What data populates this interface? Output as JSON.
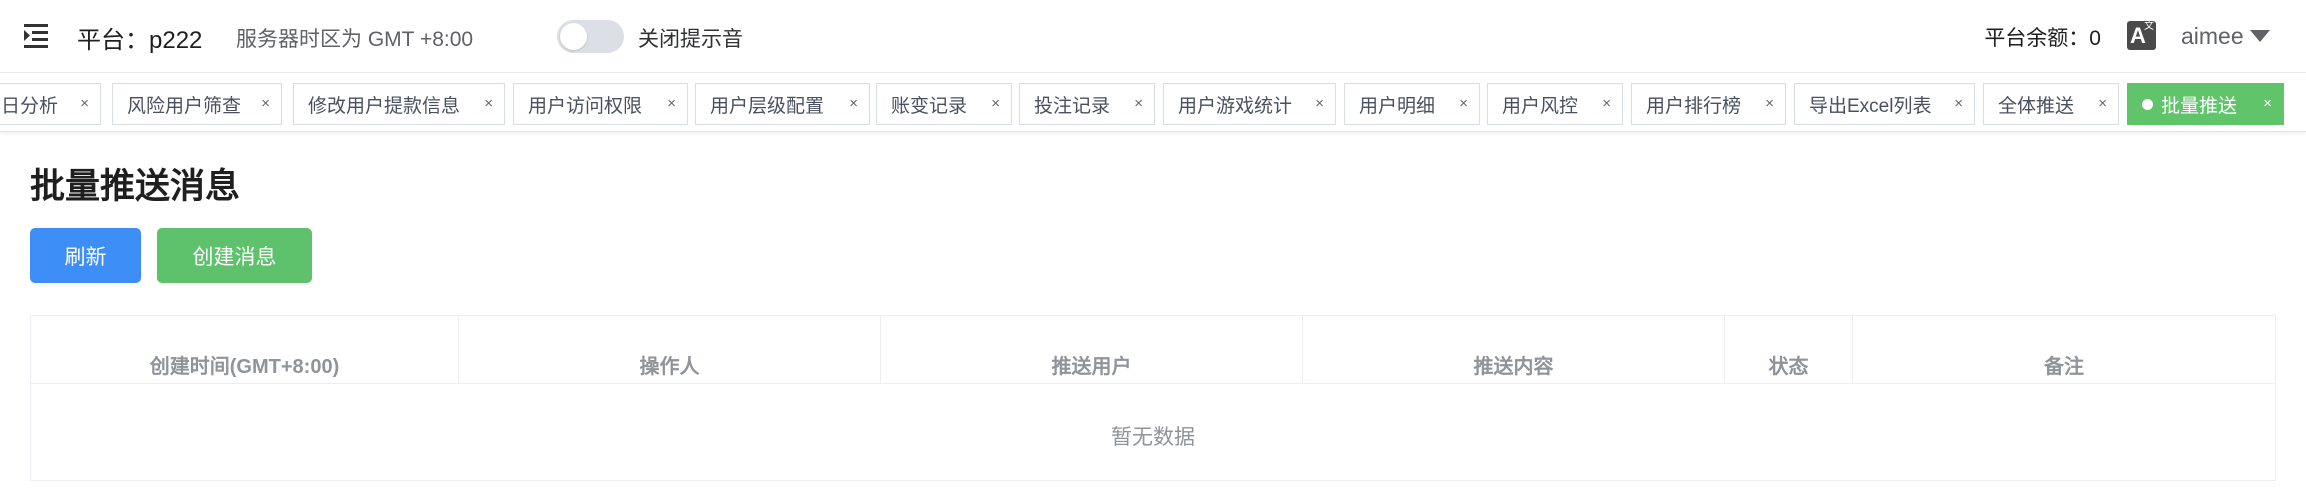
{
  "header": {
    "platform": "平台：p222",
    "timezone": "服务器时区为 GMT +8:00",
    "sound_toggle_label": "关闭提示音",
    "sound_toggle_on": false,
    "balance": "平台余额：0",
    "translate_icon_main": "A",
    "translate_icon_sub": "文",
    "username": "aimee"
  },
  "tabs": [
    {
      "label": "日分析",
      "active": false
    },
    {
      "label": "风险用户筛查",
      "active": false
    },
    {
      "label": "修改用户提款信息",
      "active": false
    },
    {
      "label": "用户访问权限",
      "active": false
    },
    {
      "label": "用户层级配置",
      "active": false
    },
    {
      "label": "账变记录",
      "active": false
    },
    {
      "label": "投注记录",
      "active": false
    },
    {
      "label": "用户游戏统计",
      "active": false
    },
    {
      "label": "用户明细",
      "active": false
    },
    {
      "label": "用户风控",
      "active": false
    },
    {
      "label": "用户排行榜",
      "active": false
    },
    {
      "label": "导出Excel列表",
      "active": false
    },
    {
      "label": "全体推送",
      "active": false
    },
    {
      "label": "批量推送",
      "active": true
    }
  ],
  "tab_close_glyph": "×",
  "page": {
    "title": "批量推送消息",
    "refresh_button": "刷新",
    "create_button": "创建消息"
  },
  "table": {
    "columns": [
      "创建时间(GMT+8:00)",
      "操作人",
      "推送用户",
      "推送内容",
      "状态",
      "备注"
    ],
    "empty_text": "暂无数据"
  },
  "colors": {
    "primary": "#3e8ef7",
    "success": "#5ec16b",
    "active_tab": "#5fc46a"
  }
}
